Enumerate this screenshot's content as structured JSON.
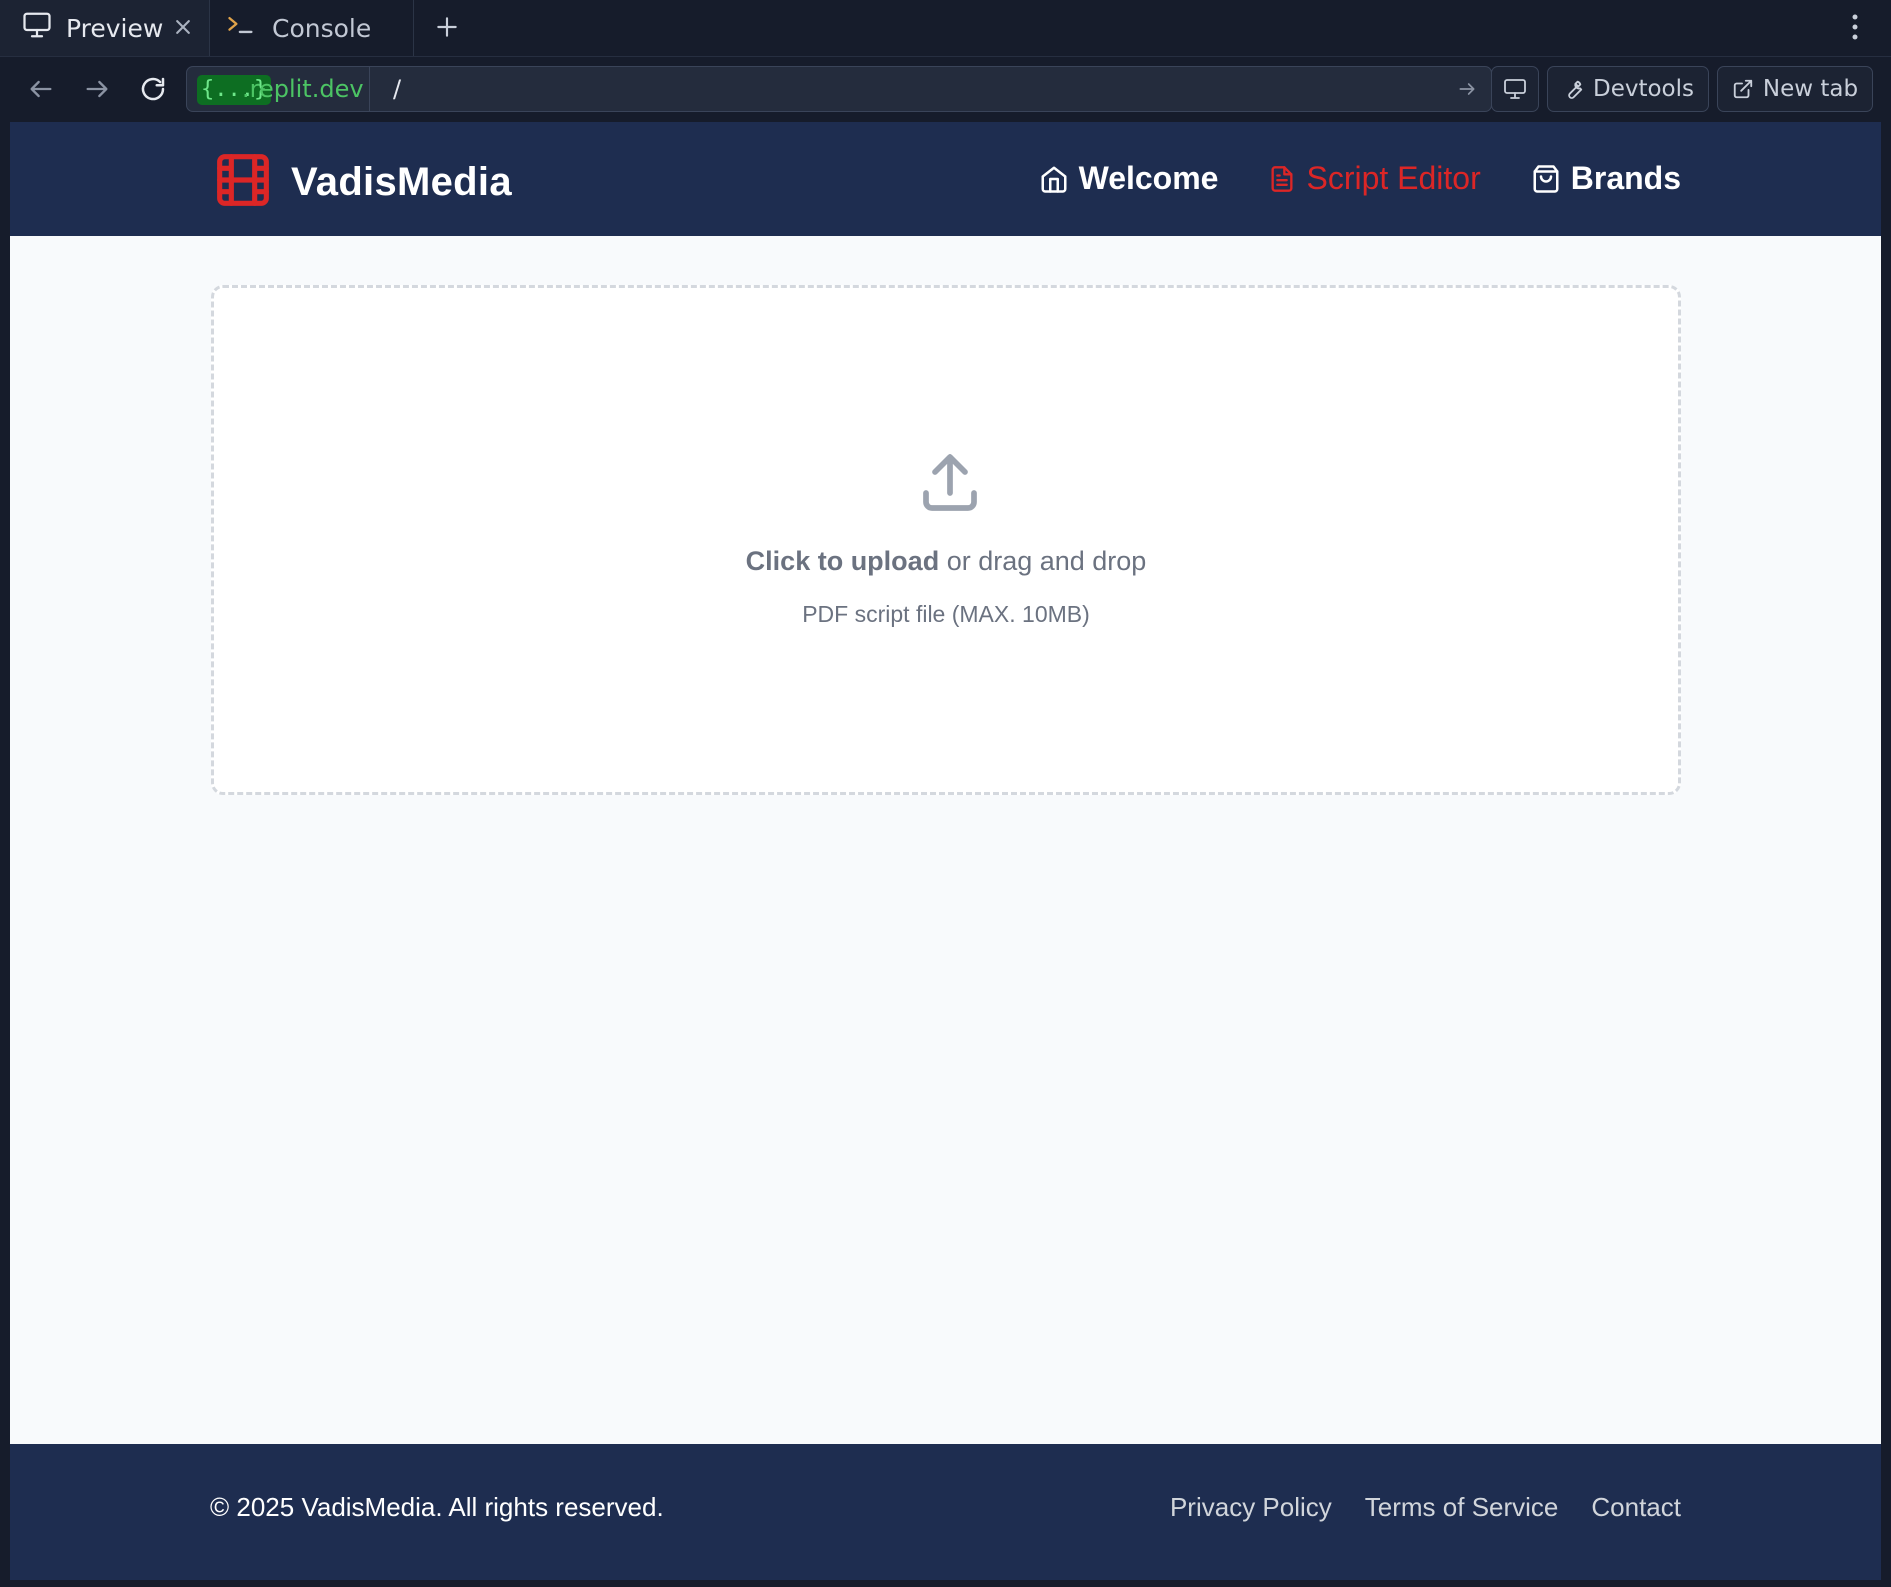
{
  "chrome": {
    "tabs": [
      {
        "label": "Preview",
        "icon": "monitor-icon"
      },
      {
        "label": "Console",
        "icon": "terminal-icon"
      }
    ],
    "address": {
      "domain_chip": "{...}",
      "domain_rest": ".replit.dev",
      "path": "/"
    },
    "buttons": {
      "devtools": "Devtools",
      "new_tab": "New tab"
    }
  },
  "app": {
    "brand": "VadisMedia",
    "brand_icon": "film-icon",
    "accent_color": "#dc2626",
    "header_color": "#1e2d50",
    "nav": [
      {
        "label": "Welcome",
        "icon": "home-icon",
        "active": false
      },
      {
        "label": "Script Editor",
        "icon": "file-text-icon",
        "active": true
      },
      {
        "label": "Brands",
        "icon": "shopping-bag-icon",
        "active": false
      }
    ],
    "upload": {
      "icon": "upload-icon",
      "cta_bold": "Click to upload",
      "cta_rest": " or drag and drop",
      "hint": "PDF script file (MAX. 10MB)"
    },
    "footer": {
      "copyright": "© 2025 VadisMedia. All rights reserved.",
      "links": [
        "Privacy Policy",
        "Terms of Service",
        "Contact"
      ]
    }
  }
}
